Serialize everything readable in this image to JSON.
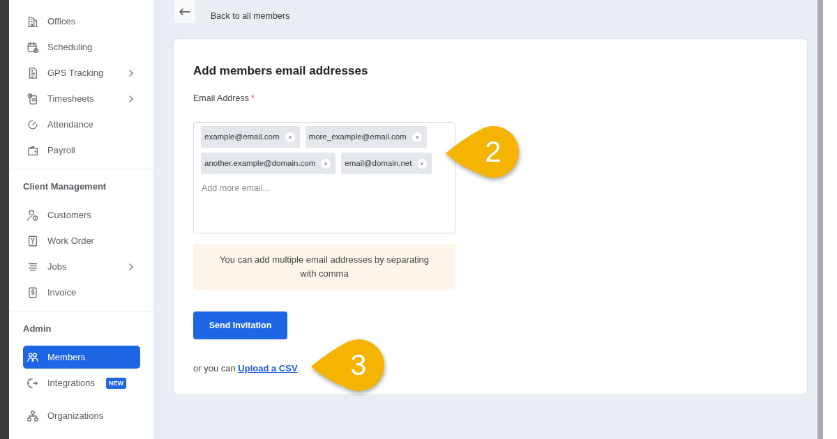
{
  "sidebar": {
    "sections": [
      {
        "items": [
          {
            "label": "Offices",
            "selected": false,
            "has_submenu": false
          },
          {
            "label": "Scheduling",
            "selected": false,
            "has_submenu": false
          },
          {
            "label": "GPS Tracking",
            "selected": false,
            "has_submenu": true
          },
          {
            "label": "Timesheets",
            "selected": false,
            "has_submenu": true
          },
          {
            "label": "Attendance",
            "selected": false,
            "has_submenu": false
          },
          {
            "label": "Payroll",
            "selected": false,
            "has_submenu": false
          }
        ]
      },
      {
        "heading": "Client Management",
        "items": [
          {
            "label": "Customers",
            "selected": false,
            "has_submenu": false
          },
          {
            "label": "Work Order",
            "selected": false,
            "has_submenu": false
          },
          {
            "label": "Jobs",
            "selected": false,
            "has_submenu": true
          },
          {
            "label": "Invoice",
            "selected": false,
            "has_submenu": false
          }
        ]
      },
      {
        "heading": "Admin",
        "items": [
          {
            "label": "Members",
            "selected": true,
            "has_submenu": false
          },
          {
            "label": "Integrations",
            "selected": false,
            "has_submenu": false,
            "badge": "NEW"
          },
          {
            "label": "Organizations",
            "selected": false,
            "has_submenu": false
          }
        ]
      }
    ]
  },
  "back_link": {
    "label": "Back to all members"
  },
  "form": {
    "title": "Add members email addresses",
    "email_field": {
      "label": "Email Address",
      "required_mark": "*",
      "tags": [
        "example@email.com",
        "more_example@email.com",
        "another.example@domain.com",
        "email@domain.net"
      ],
      "placeholder": "Add more email...",
      "callout": "2"
    },
    "hint": "You can add multiple email addresses by separating with comma",
    "submit_button": "Send Invitation",
    "upload": {
      "text": "or you can",
      "link": "Upload a CSV",
      "callout": "3"
    }
  }
}
